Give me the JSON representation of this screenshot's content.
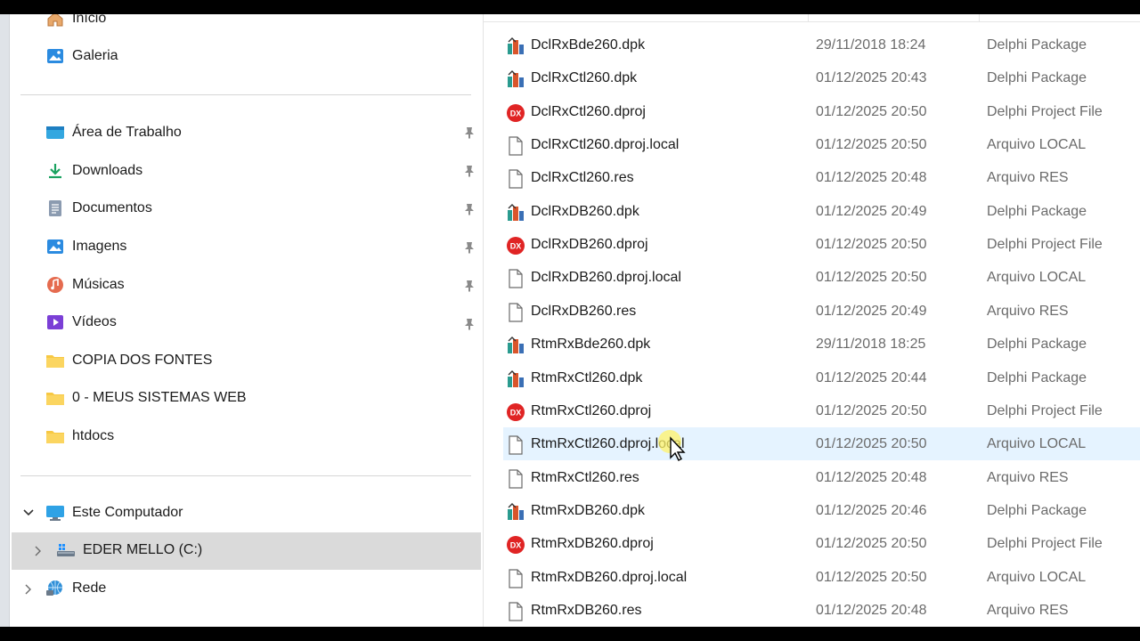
{
  "sidebar": {
    "top_items": [
      {
        "label": "Início",
        "icon": "home-icon"
      },
      {
        "label": "Galeria",
        "icon": "gallery-icon"
      }
    ],
    "pinned": [
      {
        "label": "Área de Trabalho",
        "icon": "desktop-icon"
      },
      {
        "label": "Downloads",
        "icon": "download-icon"
      },
      {
        "label": "Documentos",
        "icon": "documents-icon"
      },
      {
        "label": "Imagens",
        "icon": "pictures-icon"
      },
      {
        "label": "Músicas",
        "icon": "music-icon"
      },
      {
        "label": "Vídeos",
        "icon": "videos-icon"
      }
    ],
    "folders": [
      {
        "label": "COPIA DOS FONTES",
        "icon": "folder-icon"
      },
      {
        "label": "0 - MEUS SISTEMAS WEB",
        "icon": "folder-icon"
      },
      {
        "label": "htdocs",
        "icon": "folder-icon"
      }
    ],
    "computer": {
      "label": "Este Computador",
      "icon": "computer-icon"
    },
    "drive": {
      "label": "EDER MELLO (C:)",
      "icon": "drive-icon"
    },
    "network": {
      "label": "Rede",
      "icon": "network-icon"
    }
  },
  "files": [
    {
      "name": "DclRxBde260.dpk",
      "date": "29/11/2018 18:24",
      "type": "Delphi Package",
      "icon": "delphi-package-icon"
    },
    {
      "name": "DclRxCtl260.dpk",
      "date": "01/12/2025 20:43",
      "type": "Delphi Package",
      "icon": "delphi-package-icon"
    },
    {
      "name": "DclRxCtl260.dproj",
      "date": "01/12/2025 20:50",
      "type": "Delphi Project File",
      "icon": "delphi-project-icon"
    },
    {
      "name": "DclRxCtl260.dproj.local",
      "date": "01/12/2025 20:50",
      "type": "Arquivo LOCAL",
      "icon": "blank-file-icon"
    },
    {
      "name": "DclRxCtl260.res",
      "date": "01/12/2025 20:48",
      "type": "Arquivo RES",
      "icon": "blank-file-icon"
    },
    {
      "name": "DclRxDB260.dpk",
      "date": "01/12/2025 20:49",
      "type": "Delphi Package",
      "icon": "delphi-package-icon"
    },
    {
      "name": "DclRxDB260.dproj",
      "date": "01/12/2025 20:50",
      "type": "Delphi Project File",
      "icon": "delphi-project-icon"
    },
    {
      "name": "DclRxDB260.dproj.local",
      "date": "01/12/2025 20:50",
      "type": "Arquivo LOCAL",
      "icon": "blank-file-icon"
    },
    {
      "name": "DclRxDB260.res",
      "date": "01/12/2025 20:49",
      "type": "Arquivo RES",
      "icon": "blank-file-icon"
    },
    {
      "name": "RtmRxBde260.dpk",
      "date": "29/11/2018 18:25",
      "type": "Delphi Package",
      "icon": "delphi-package-icon"
    },
    {
      "name": "RtmRxCtl260.dpk",
      "date": "01/12/2025 20:44",
      "type": "Delphi Package",
      "icon": "delphi-package-icon"
    },
    {
      "name": "RtmRxCtl260.dproj",
      "date": "01/12/2025 20:50",
      "type": "Delphi Project File",
      "icon": "delphi-project-icon"
    },
    {
      "name": "RtmRxCtl260.dproj.local",
      "date": "01/12/2025 20:50",
      "type": "Arquivo LOCAL",
      "icon": "blank-file-icon"
    },
    {
      "name": "RtmRxCtl260.res",
      "date": "01/12/2025 20:48",
      "type": "Arquivo RES",
      "icon": "blank-file-icon"
    },
    {
      "name": "RtmRxDB260.dpk",
      "date": "01/12/2025 20:46",
      "type": "Delphi Package",
      "icon": "delphi-package-icon"
    },
    {
      "name": "RtmRxDB260.dproj",
      "date": "01/12/2025 20:50",
      "type": "Delphi Project File",
      "icon": "delphi-project-icon"
    },
    {
      "name": "RtmRxDB260.dproj.local",
      "date": "01/12/2025 20:50",
      "type": "Arquivo LOCAL",
      "icon": "blank-file-icon"
    },
    {
      "name": "RtmRxDB260.res",
      "date": "01/12/2025 20:48",
      "type": "Arquivo RES",
      "icon": "blank-file-icon"
    }
  ],
  "colors": {
    "hover_row": "#e5f3ff",
    "selected_nav": "#dadada",
    "delphi_red": "#e02424",
    "folder_yellow": "#f7c843"
  }
}
